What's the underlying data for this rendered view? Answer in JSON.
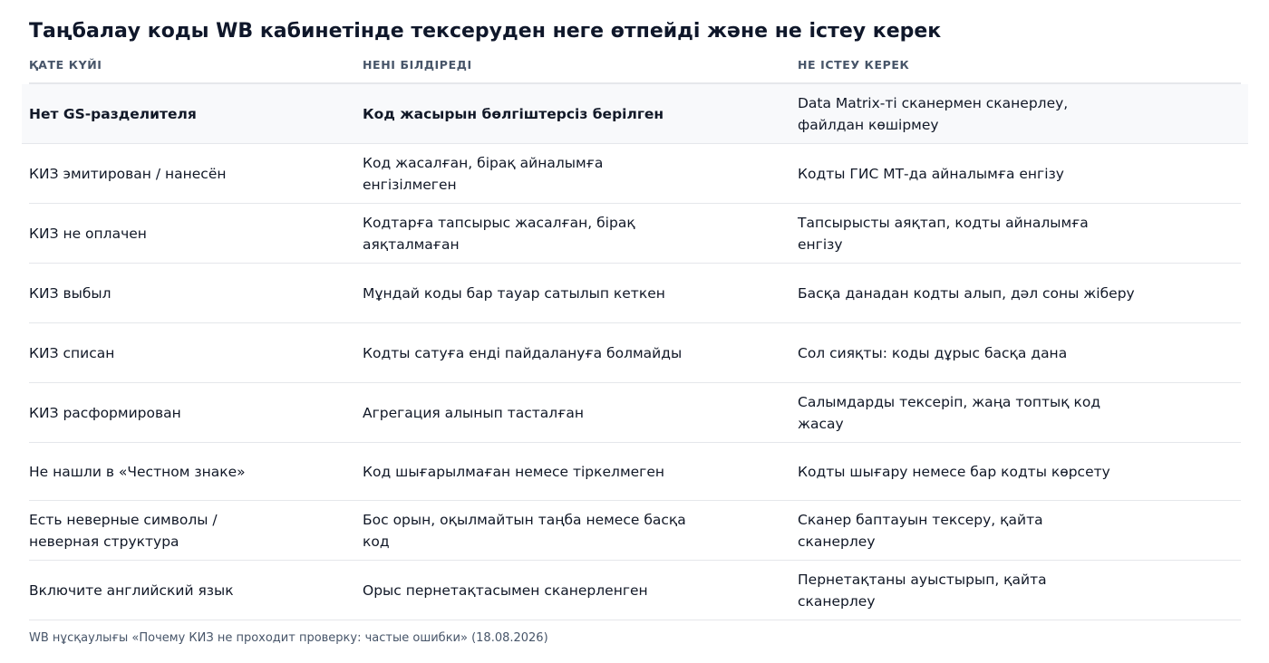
{
  "title": "Таңбалау коды WB кабинетінде тексеруден неге өтпейді және не істеу керек",
  "headers": {
    "status": "ҚАТЕ КҮЙІ",
    "meaning": "НЕНІ БІЛДІРЕДІ",
    "action": "НЕ ІСТЕУ КЕРЕК"
  },
  "rows": [
    {
      "status": "Нет GS-разделителя",
      "meaning": "Код жасырын бөлгіштерсіз берілген",
      "action": "Data Matrix-ті сканермен сканерлеу, файлдан көшірмеу"
    },
    {
      "status": "КИЗ эмитирован / нанесён",
      "meaning": "Код жасалған, бірақ айналымға енгізілмеген",
      "action": "Кодты ГИС МТ-да айналымға енгізу"
    },
    {
      "status": "КИЗ не оплачен",
      "meaning": "Кодтарға тапсырыс жасалған, бірақ аяқталмаған",
      "action": "Тапсырысты аяқтап, кодты айналымға енгізу"
    },
    {
      "status": "КИЗ выбыл",
      "meaning": "Мұндай коды бар тауар сатылып кеткен",
      "action": "Басқа данадан кодты алып, дәл соны жіберу"
    },
    {
      "status": "КИЗ списан",
      "meaning": "Кодты сатуға енді пайдалануға болмайды",
      "action": "Сол сияқты: коды дұрыс басқа дана"
    },
    {
      "status": "КИЗ расформирован",
      "meaning": "Агрегация алынып тасталған",
      "action": "Салымдарды тексеріп, жаңа топтық код жасау"
    },
    {
      "status": "Не нашли в «Честном знаке»",
      "meaning": "Код шығарылмаған немесе тіркелмеген",
      "action": "Кодты шығару немесе бар кодты көрсету"
    },
    {
      "status": "Есть неверные символы / неверная структура",
      "meaning": "Бос орын, оқылмайтын таңба немесе басқа код",
      "action": "Сканер баптауын тексеру, қайта сканерлеу"
    },
    {
      "status": "Включите английский язык",
      "meaning": "Орыс пернетақтасымен сканерленген",
      "action": "Пернетақтаны ауыстырып, қайта сканерлеу"
    }
  ],
  "footer": "WB нұсқаулығы «Почему КИЗ не проходит проверку: частые ошибки» (18.08.2026)"
}
